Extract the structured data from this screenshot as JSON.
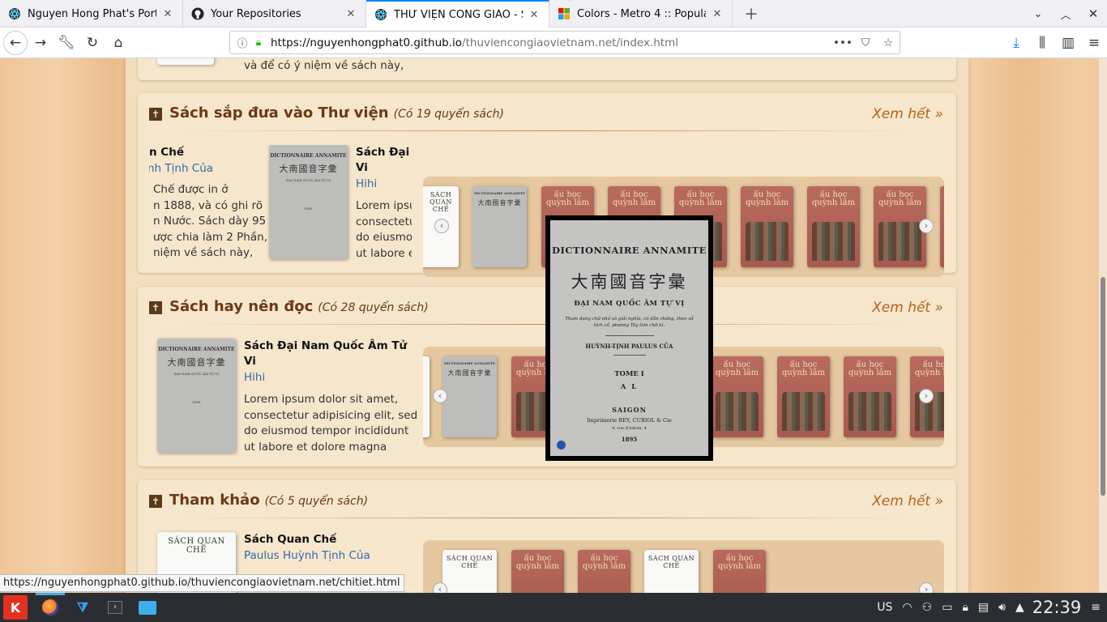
{
  "browser": {
    "tabs": [
      {
        "title": "Nguyen Hong Phat's Portfo",
        "icon": "react-icon"
      },
      {
        "title": "Your Repositories",
        "icon": "github-icon"
      },
      {
        "title": "THƯ VIỆN CÔNG GIÁO - Sit",
        "icon": "react-icon",
        "active": true
      },
      {
        "title": "Colors - Metro 4 :: Popular",
        "icon": "metro-icon"
      }
    ],
    "url_host": "https://nguyenhongphat0.github.io",
    "url_path": "/thuviencongiaovietnam.net/index.html",
    "status_url": "https://nguyenhongphat0.github.io/thuviencongiaovietnam.net/chitiet.html"
  },
  "page": {
    "top_partial_text": "và để có ý niệm về sách này,",
    "sections": [
      {
        "name": "Sách sắp đưa vào Thư viện",
        "count": "(Có 19 quyển sách)",
        "more": "Xem hết",
        "books": [
          {
            "title": "n Chế",
            "author": "ynh Tịnh Của",
            "desc": "Chế được in ở\nn 1888, và có ghi rõ\nn Nước. Sách dày 95\nược chia làm 2 Phần,\nniệm về sách này,"
          },
          {
            "title": "Sách Đại\nVi",
            "author": "Hihi",
            "desc": "Lorem ipsu\nconsectetu\ndo eiusmo\nut labore e"
          }
        ]
      },
      {
        "name": "Sách hay nên đọc",
        "count": "(Có 28 quyển sách)",
        "more": "Xem hết",
        "books": [
          {
            "title": "Sách Đại Nam Quốc Âm Tử\nVi",
            "author": "Hihi",
            "desc": "Lorem ipsum dolor sit amet,\nconsectetur adipisicing elit, sed\ndo eiusmod tempor incididunt\nut labore et dolore magna"
          }
        ]
      },
      {
        "name": "Tham khảo",
        "count": "(Có 5 quyển sách)",
        "more": "Xem hết",
        "books": [
          {
            "title": "Sách Quan Chế",
            "author": "Paulus Huỳnh Tịnh Của"
          }
        ]
      }
    ],
    "covers": {
      "dict_title": "DICTIONNAIRE ANNAMITE",
      "dict_chinese": "大南國音字彙",
      "dict_vn": "ĐẠI NAM QUỐC ÂM TỰ VỊ",
      "dict_sub": "Tham dụng chữ nhỏ và giải nghĩa, có dẫn chứng, theo sử tích cổ, phương Tây làm chữ kí.",
      "dict_author": "HUỲNH-TỊNH PAULUS CỦA",
      "dict_tome": "TOME I",
      "dict_al": "A L",
      "dict_city": "SAIGON",
      "dict_printer": "Imprimerie REY, CURIOL & Cie",
      "dict_addr": "4, rue d'Adran, 4",
      "dict_year": "1895",
      "auhoc": "ấu học\nquỳnh lâm",
      "quanche": "SÁCH QUAN CHẾ"
    }
  },
  "taskbar": {
    "lang": "US",
    "clock": "22:39"
  }
}
